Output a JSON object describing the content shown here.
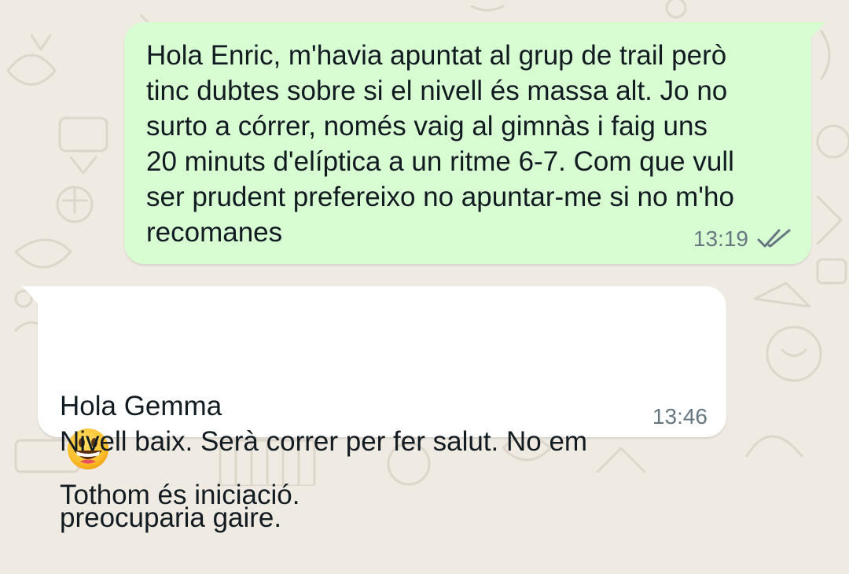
{
  "chat": {
    "messages": [
      {
        "direction": "outgoing",
        "text": "Hola Enric, m'havia apuntat al grup de trail però\ntinc dubtes sobre si el nivell és massa alt. Jo no\nsurto a córrer, només vaig al gimnàs i faig uns\n20 minuts d'elíptica a un ritme 6-7. Com que vull\nser prudent prefereixo no apuntar-me si no m'ho\nrecomanes",
        "time": "13:19",
        "status_icon": "double-check-icon"
      },
      {
        "direction": "incoming",
        "line1_before_emoji": "Hola Gemma",
        "emoji": "grinning-face-emoji",
        "line1_after_emoji": "Tothom és iniciació.",
        "line2": "Nivell baix. Serà correr per fer salut. No em",
        "line3": "preocuparia gaire.",
        "time": "13:46"
      }
    ]
  },
  "colors": {
    "wallpaper": "#efeae2",
    "outgoing_bubble": "#d9fdd3",
    "incoming_bubble": "#ffffff",
    "text": "#111b21",
    "meta": "#667781"
  }
}
